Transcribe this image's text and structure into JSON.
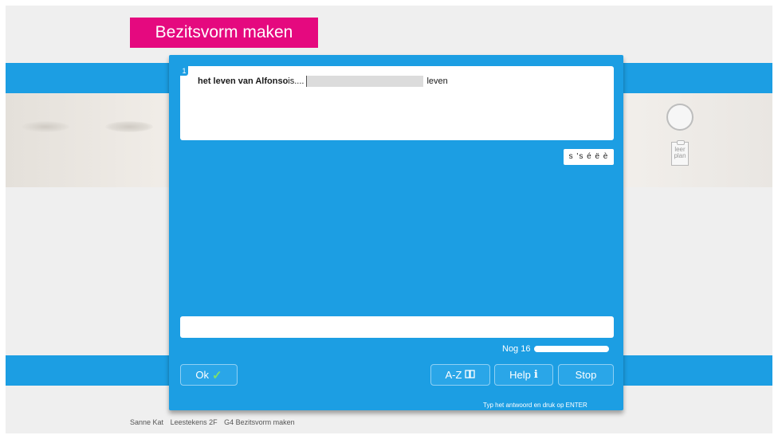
{
  "header": {
    "title": "Bezitsvorm maken"
  },
  "side": {
    "leerplan_label": "leer plan"
  },
  "question": {
    "number": "1",
    "bold_text": "het leven van Alfonso",
    "text_after": " is....",
    "suffix": "leven"
  },
  "special_chars": "s 's é ë è",
  "answer": {
    "value": "",
    "placeholder": ""
  },
  "progress": {
    "label": "Nog 16",
    "fraction": 1.0
  },
  "buttons": {
    "ok": "Ok",
    "az": "A-Z",
    "help": "Help",
    "stop": "Stop"
  },
  "icons": {
    "ok": "check-icon",
    "az": "book-icon",
    "help": "info-icon"
  },
  "hint": "Typ het antwoord en druk op ENTER",
  "footer": {
    "user": "Sanne Kat",
    "course": "Leestekens 2F",
    "exercise": "G4 Bezitsvorm maken"
  },
  "colors": {
    "accent_blue": "#1c9ee3",
    "title_pink": "#e5097f",
    "check_green": "#7ee06a"
  }
}
